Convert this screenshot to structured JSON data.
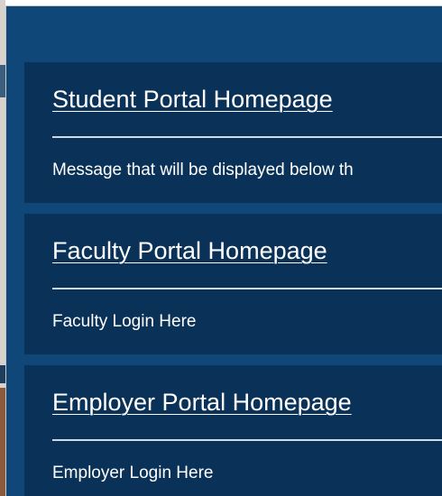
{
  "portals": [
    {
      "title": "Student Portal Homepage",
      "message": "Message that will be displayed below th"
    },
    {
      "title": "Faculty Portal Homepage",
      "message": "Faculty Login Here"
    },
    {
      "title": "Employer Portal Homepage",
      "message": "Employer Login Here"
    }
  ],
  "colors": {
    "modal_background": "#0f4878",
    "card_background": "#0a3258",
    "text": "#ffffff",
    "divider": "#cfd8e3"
  }
}
